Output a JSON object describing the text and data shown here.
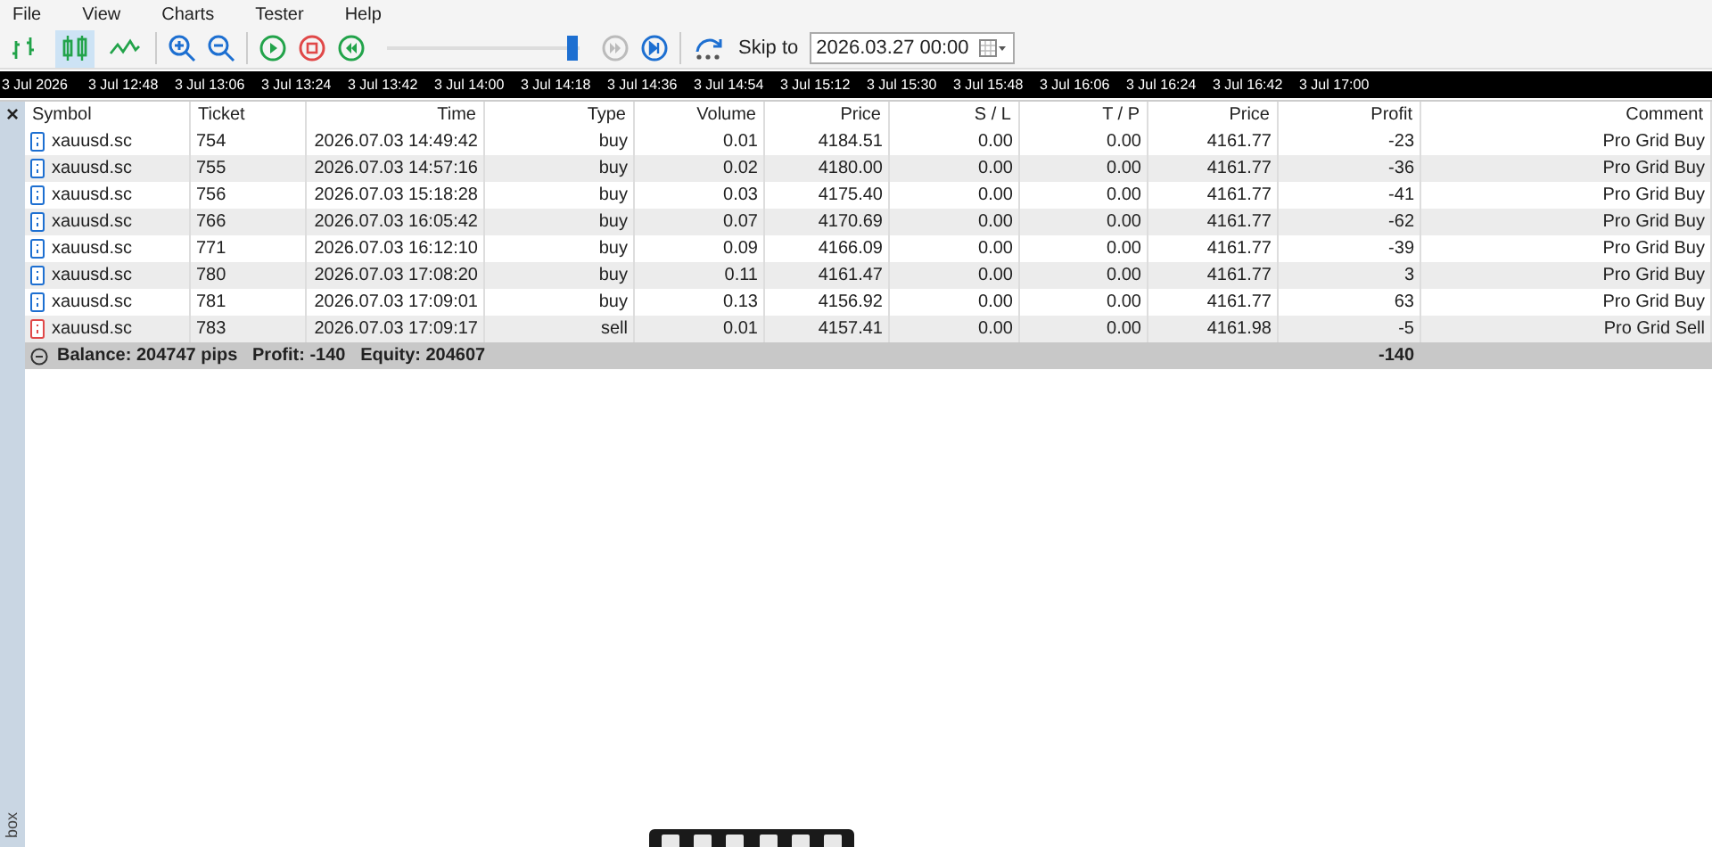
{
  "menu": [
    "File",
    "View",
    "Charts",
    "Tester",
    "Help"
  ],
  "toolbar": {
    "chart_types": [
      {
        "kind": "bars",
        "selected": false
      },
      {
        "kind": "candles",
        "selected": true
      },
      {
        "kind": "line",
        "selected": false
      }
    ],
    "speed": {
      "level": 0.96
    },
    "skip_label": "Skip to",
    "skip_date": "2026.03.27 00:00"
  },
  "time_axis": [
    "3 Jul 2026",
    "3 Jul 12:48",
    "3 Jul 13:06",
    "3 Jul 13:24",
    "3 Jul 13:42",
    "3 Jul 14:00",
    "3 Jul 14:18",
    "3 Jul 14:36",
    "3 Jul 14:54",
    "3 Jul 15:12",
    "3 Jul 15:30",
    "3 Jul 15:48",
    "3 Jul 16:06",
    "3 Jul 16:24",
    "3 Jul 16:42",
    "3 Jul 17:00"
  ],
  "panel": {
    "close": "×",
    "side_label": "box"
  },
  "table": {
    "columns": [
      "Symbol",
      "Ticket",
      "Time",
      "Type",
      "Volume",
      "Price",
      "S / L",
      "T / P",
      "Price",
      "Profit",
      "Comment"
    ],
    "rows": [
      {
        "kind": "buy",
        "cells": [
          "xauusd.sc",
          "754",
          "2026.07.03 14:49:42",
          "buy",
          "0.01",
          "4184.51",
          "0.00",
          "0.00",
          "4161.77",
          "-23",
          "Pro Grid Buy"
        ]
      },
      {
        "kind": "buy",
        "cells": [
          "xauusd.sc",
          "755",
          "2026.07.03 14:57:16",
          "buy",
          "0.02",
          "4180.00",
          "0.00",
          "0.00",
          "4161.77",
          "-36",
          "Pro Grid Buy"
        ]
      },
      {
        "kind": "buy",
        "cells": [
          "xauusd.sc",
          "756",
          "2026.07.03 15:18:28",
          "buy",
          "0.03",
          "4175.40",
          "0.00",
          "0.00",
          "4161.77",
          "-41",
          "Pro Grid Buy"
        ]
      },
      {
        "kind": "buy",
        "cells": [
          "xauusd.sc",
          "766",
          "2026.07.03 16:05:42",
          "buy",
          "0.07",
          "4170.69",
          "0.00",
          "0.00",
          "4161.77",
          "-62",
          "Pro Grid Buy"
        ]
      },
      {
        "kind": "buy",
        "cells": [
          "xauusd.sc",
          "771",
          "2026.07.03 16:12:10",
          "buy",
          "0.09",
          "4166.09",
          "0.00",
          "0.00",
          "4161.77",
          "-39",
          "Pro Grid Buy"
        ]
      },
      {
        "kind": "buy",
        "cells": [
          "xauusd.sc",
          "780",
          "2026.07.03 17:08:20",
          "buy",
          "0.11",
          "4161.47",
          "0.00",
          "0.00",
          "4161.77",
          "3",
          "Pro Grid Buy"
        ]
      },
      {
        "kind": "buy",
        "cells": [
          "xauusd.sc",
          "781",
          "2026.07.03 17:09:01",
          "buy",
          "0.13",
          "4156.92",
          "0.00",
          "0.00",
          "4161.77",
          "63",
          "Pro Grid Buy"
        ]
      },
      {
        "kind": "sell",
        "cells": [
          "xauusd.sc",
          "783",
          "2026.07.03 17:09:17",
          "sell",
          "0.01",
          "4157.41",
          "0.00",
          "0.00",
          "4161.98",
          "-5",
          "Pro Grid Sell"
        ]
      }
    ],
    "summary": {
      "expanded": true,
      "text": "Balance: 204747 pips   Profit: -140   Equity: 204607",
      "profit": "-140"
    }
  }
}
